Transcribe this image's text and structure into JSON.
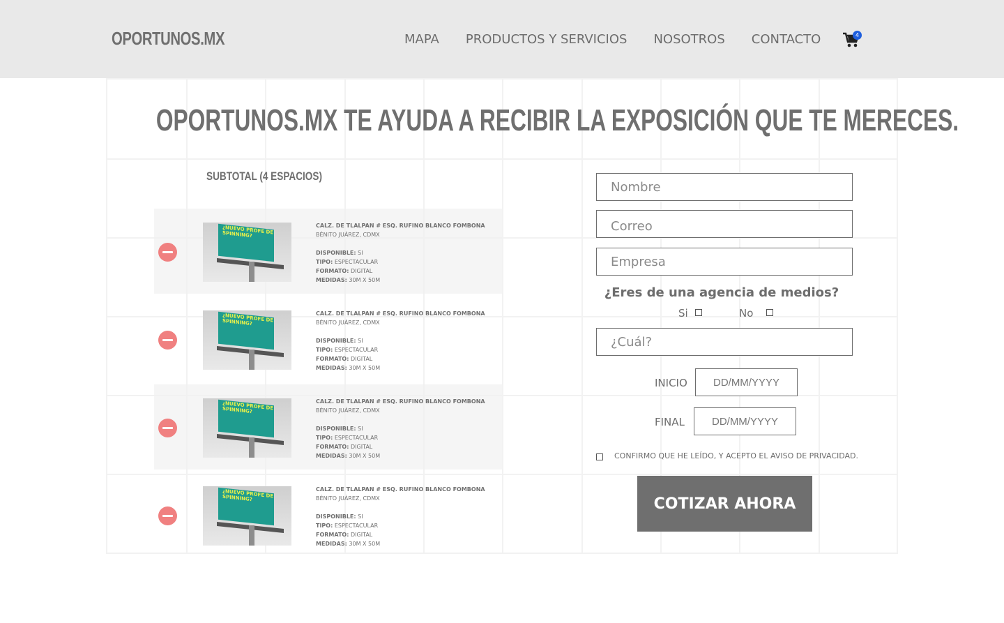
{
  "header": {
    "logo": "OPORTUNOS.MX",
    "nav": [
      "MAPA",
      "PRODUCTOS Y SERVICIOS",
      "NOSOTROS",
      "CONTACTO"
    ],
    "cart_count": "4"
  },
  "main": {
    "headline": "OPORTUNOS.MX TE AYUDA A RECIBIR LA EXPOSICIÓN QUE TE MERECES.",
    "subtotal": "SUBTOTAL (4 ESPACIOS)"
  },
  "items": [
    {
      "address": "CALZ. DE TLALPAN # ESQ. RUFINO BLANCO FOMBONA",
      "city": "BÉNITO JUÁREZ, CDMX",
      "disponible_label": "DISPONIBLE:",
      "disponible": "SI",
      "tipo_label": "TIPO:",
      "tipo": "ESPECTACULAR",
      "formato_label": "FORMATO:",
      "formato": "DIGITAL",
      "medidas_label": "MEDIDAS:",
      "medidas": "30M X 50M",
      "ad_text": "¿NUEVO PROFE DE SPINNING?"
    },
    {
      "address": "CALZ. DE TLALPAN # ESQ. RUFINO BLANCO FOMBONA",
      "city": "BÉNITO JUÁREZ, CDMX",
      "disponible_label": "DISPONIBLE:",
      "disponible": "SI",
      "tipo_label": "TIPO:",
      "tipo": "ESPECTACULAR",
      "formato_label": "FORMATO:",
      "formato": "DIGITAL",
      "medidas_label": "MEDIDAS:",
      "medidas": "30M X 50M",
      "ad_text": "¿NUEVO PROFE DE SPINNING?"
    },
    {
      "address": "CALZ. DE TLALPAN # ESQ. RUFINO BLANCO FOMBONA",
      "city": "BÉNITO JUÁREZ, CDMX",
      "disponible_label": "DISPONIBLE:",
      "disponible": "SI",
      "tipo_label": "TIPO:",
      "tipo": "ESPECTACULAR",
      "formato_label": "FORMATO:",
      "formato": "DIGITAL",
      "medidas_label": "MEDIDAS:",
      "medidas": "30M X 50M",
      "ad_text": "¿NUEVO PROFE DE SPINNING?"
    },
    {
      "address": "CALZ. DE TLALPAN # ESQ. RUFINO BLANCO FOMBONA",
      "city": "BÉNITO JUÁREZ, CDMX",
      "disponible_label": "DISPONIBLE:",
      "disponible": "SI",
      "tipo_label": "TIPO:",
      "tipo": "ESPECTACULAR",
      "formato_label": "FORMATO:",
      "formato": "DIGITAL",
      "medidas_label": "MEDIDAS:",
      "medidas": "30M X 50M",
      "ad_text": "¿NUEVO PROFE DE SPINNING?"
    }
  ],
  "form": {
    "nombre_placeholder": "Nombre",
    "correo_placeholder": "Correo",
    "empresa_placeholder": "Empresa",
    "agency_question": "¿Eres de una agencia de medios?",
    "option_yes": "Si",
    "option_no": "No",
    "cual_placeholder": "¿Cuál?",
    "inicio_label": "INICIO",
    "final_label": "FINAL",
    "date_placeholder": "DD/MM/YYYY",
    "privacy_text": "CONFIRMO QUE HE LEÍDO, Y ACEPTO EL AVISO DE PRIVACIDAD.",
    "submit_label": "COTIZAR AHORA"
  },
  "colors": {
    "header_bg": "#e9e9e9",
    "text": "#6d6d6d",
    "remove": "#f08080",
    "badge": "#1f5fde",
    "button": "#6f6f6f"
  }
}
